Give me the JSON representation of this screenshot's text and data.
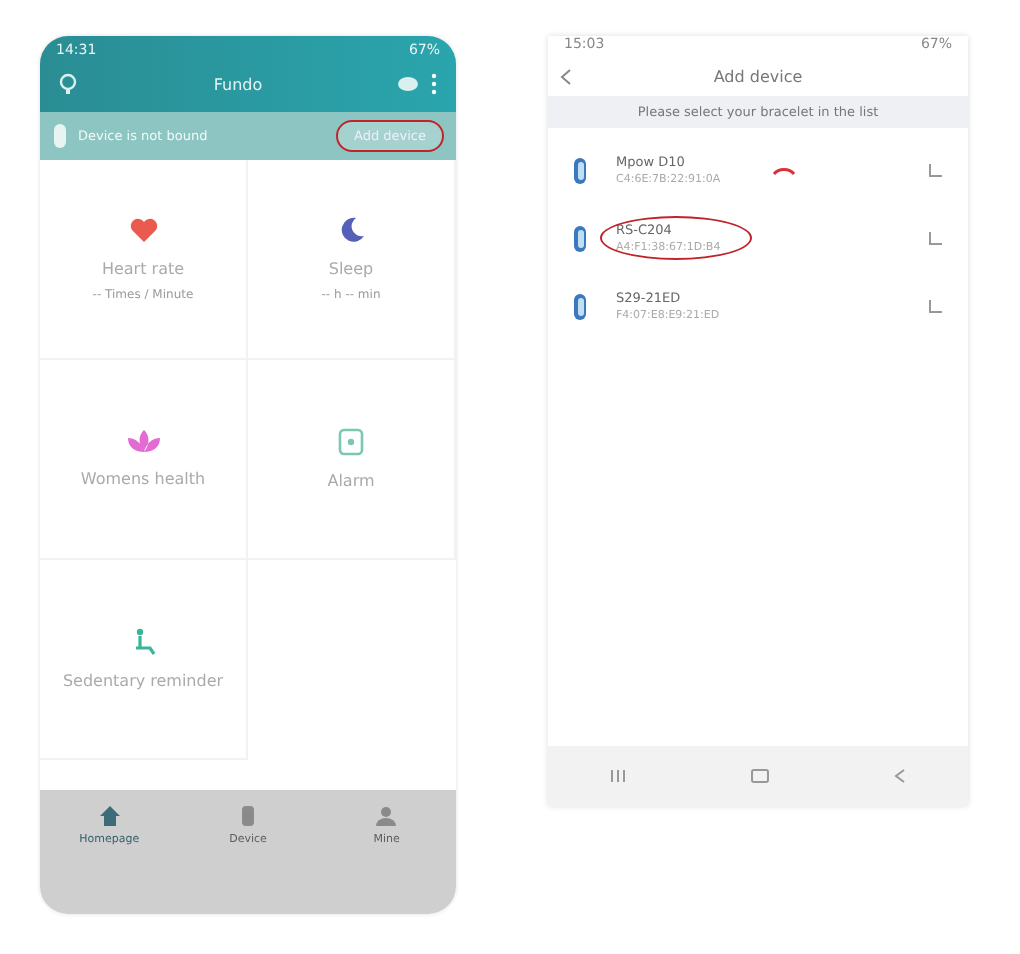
{
  "left_phone": {
    "status_time": "14:31",
    "status_battery": "67%",
    "title": "Fundo",
    "banner": {
      "text": "Device is not bound",
      "button": "Add device",
      "highlighted": true
    },
    "cards": [
      {
        "kind": "heart",
        "label": "Heart rate",
        "value": "-- Times / Minute"
      },
      {
        "kind": "sleep",
        "label": "Sleep",
        "value": "-- h -- min"
      },
      {
        "kind": "lotus",
        "label": "Womens health"
      },
      {
        "kind": "alarm",
        "label": "Alarm"
      },
      {
        "kind": "sit",
        "label": "Sedentary reminder"
      }
    ],
    "nav": [
      {
        "kind": "home",
        "label": "Homepage",
        "selected": true
      },
      {
        "kind": "device",
        "label": "Device",
        "selected": false
      },
      {
        "kind": "mine",
        "label": "Mine",
        "selected": false
      }
    ]
  },
  "right_phone": {
    "status_time": "15:03",
    "status_battery": "67%",
    "title": "Add device",
    "hint": "Please select your bracelet in the list",
    "devices": [
      {
        "name": "Mpow D10",
        "address": "C4:6E:7B:22:91:0A",
        "highlighted": false,
        "connecting": true
      },
      {
        "name": "RS-C204",
        "address": "A4:F1:38:67:1D:B4",
        "highlighted": true,
        "connecting": false
      },
      {
        "name": "S29-21ED",
        "address": "F4:07:E8:E9:21:ED",
        "highlighted": false,
        "connecting": false
      }
    ]
  }
}
